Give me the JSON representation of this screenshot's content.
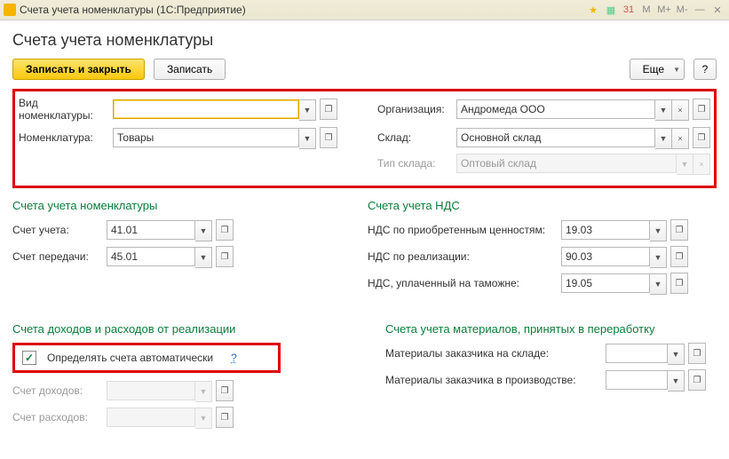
{
  "titlebar": {
    "text": "Счета учета номенклатуры  (1С:Предприятие)"
  },
  "page_title": "Счета учета номенклатуры",
  "toolbar": {
    "save_close": "Записать и закрыть",
    "save": "Записать",
    "more": "Еще",
    "help": "?"
  },
  "top": {
    "vid_label": "Вид номенклатуры:",
    "vid_value": "",
    "org_label": "Организация:",
    "org_value": "Андромеда ООО",
    "nomen_label": "Номенклатура:",
    "nomen_value": "Товары",
    "sklad_label": "Склад:",
    "sklad_value": "Основной склад",
    "tip_label": "Тип склада:",
    "tip_value": "Оптовый склад"
  },
  "accounts": {
    "section": "Счета учета номенклатуры",
    "uchet_label": "Счет учета:",
    "uchet_value": "41.01",
    "peredacha_label": "Счет передачи:",
    "peredacha_value": "45.01"
  },
  "vat": {
    "section": "Счета учета НДС",
    "acq_label": "НДС по приобретенным ценностям:",
    "acq_value": "19.03",
    "real_label": "НДС по реализации:",
    "real_value": "90.03",
    "customs_label": "НДС, уплаченный на таможне:",
    "customs_value": "19.05"
  },
  "income": {
    "section": "Счета доходов и расходов от реализации",
    "auto_label": "Определять счета автоматически",
    "auto_checked": true,
    "help": "?",
    "doh_label": "Счет доходов:",
    "doh_value": "",
    "ras_label": "Счет расходов:",
    "ras_value": ""
  },
  "materials": {
    "section": "Счета учета материалов, принятых в переработку",
    "sklad_label": "Материалы заказчика на складе:",
    "sklad_value": "",
    "proizv_label": "Материалы заказчика в производстве:",
    "proizv_value": ""
  },
  "icons": {
    "drop": "▼",
    "ext": "❐",
    "clear": "×",
    "close": "✕",
    "min": "—"
  }
}
